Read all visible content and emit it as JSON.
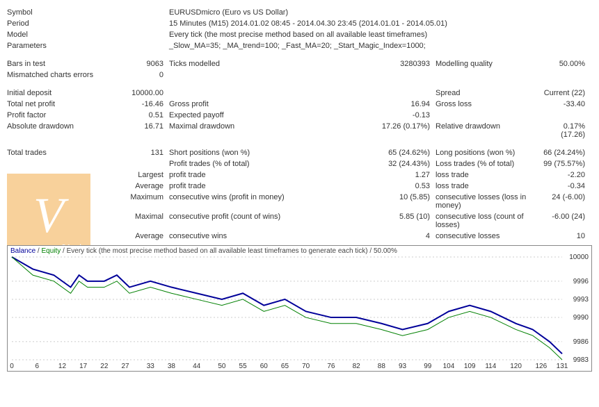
{
  "header": {
    "symbol_label": "Symbol",
    "symbol_value": "EURUSDmicro (Euro vs US Dollar)",
    "period_label": "Period",
    "period_value": "15 Minutes (M15) 2014.01.02 08:45 - 2014.04.30 23:45 (2014.01.01 - 2014.05.01)",
    "model_label": "Model",
    "model_value": "Every tick (the most precise method based on all available least timeframes)",
    "parameters_label": "Parameters",
    "parameters_value": "_Slow_MA=35; _MA_trend=100; _Fast_MA=20; _Start_Magic_Index=1000;"
  },
  "bars": {
    "bars_in_test_label": "Bars in test",
    "bars_in_test_value": "9063",
    "ticks_modelled_label": "Ticks modelled",
    "ticks_modelled_value": "3280393",
    "modelling_quality_label": "Modelling quality",
    "modelling_quality_value": "50.00%",
    "mismatched_label": "Mismatched charts errors",
    "mismatched_value": "0"
  },
  "deposit": {
    "initial_deposit_label": "Initial deposit",
    "initial_deposit_value": "10000.00",
    "spread_label": "Spread",
    "spread_value": "Current (22)",
    "total_net_profit_label": "Total net profit",
    "total_net_profit_value": "-16.46",
    "gross_profit_label": "Gross profit",
    "gross_profit_value": "16.94",
    "gross_loss_label": "Gross loss",
    "gross_loss_value": "-33.40",
    "profit_factor_label": "Profit factor",
    "profit_factor_value": "0.51",
    "expected_payoff_label": "Expected payoff",
    "expected_payoff_value": "-0.13",
    "absolute_dd_label": "Absolute drawdown",
    "absolute_dd_value": "16.71",
    "maximal_dd_label": "Maximal drawdown",
    "maximal_dd_value": "17.26 (0.17%)",
    "relative_dd_label": "Relative drawdown",
    "relative_dd_value": "0.17% (17.26)"
  },
  "trades": {
    "total_trades_label": "Total trades",
    "total_trades_value": "131",
    "short_pos_label": "Short positions (won %)",
    "short_pos_value": "65 (24.62%)",
    "long_pos_label": "Long positions (won %)",
    "long_pos_value": "66 (24.24%)",
    "profit_trades_label": "Profit trades (% of total)",
    "profit_trades_value": "32 (24.43%)",
    "loss_trades_label": "Loss trades (% of total)",
    "loss_trades_value": "99 (75.57%)",
    "largest_label": "Largest",
    "largest_profit_trade_label": "profit trade",
    "largest_profit_trade_value": "1.27",
    "largest_loss_trade_label": "loss trade",
    "largest_loss_trade_value": "-2.20",
    "average_label": "Average",
    "avg_profit_trade_label": "profit trade",
    "avg_profit_trade_value": "0.53",
    "avg_loss_trade_label": "loss trade",
    "avg_loss_trade_value": "-0.34",
    "maximum_label": "Maximum",
    "max_cons_wins_label": "consecutive wins (profit in money)",
    "max_cons_wins_value": "10 (5.85)",
    "max_cons_losses_label": "consecutive losses (loss in money)",
    "max_cons_losses_value": "24 (-6.00)",
    "maximal_label": "Maximal",
    "maximal_cons_profit_label": "consecutive profit (count of wins)",
    "maximal_cons_profit_value": "5.85 (10)",
    "maximal_cons_loss_label": "consecutive loss (count of losses)",
    "maximal_cons_loss_value": "-6.00 (24)",
    "avg2_label": "Average",
    "avg_cons_wins_label": "consecutive wins",
    "avg_cons_wins_value": "4",
    "avg_cons_losses_label": "consecutive losses",
    "avg_cons_losses_value": "10"
  },
  "chart": {
    "legend_balance": "Balance",
    "legend_equity": "Equity",
    "legend_rest": "Every tick (the most precise method based on all available least timeframes to generate each tick) / 50.00%"
  },
  "chart_data": {
    "type": "line",
    "title": "",
    "xlabel": "",
    "ylabel": "",
    "x_ticks": [
      0,
      6,
      12,
      17,
      22,
      27,
      33,
      38,
      44,
      50,
      55,
      60,
      65,
      70,
      76,
      82,
      88,
      93,
      99,
      104,
      109,
      114,
      120,
      126,
      131
    ],
    "y_ticks": [
      9983,
      9986,
      9990,
      9993,
      9996,
      10000
    ],
    "xlim": [
      0,
      131
    ],
    "ylim": [
      9983,
      10000
    ],
    "series": [
      {
        "name": "Balance",
        "color": "#000099",
        "x": [
          0,
          5,
          10,
          14,
          16,
          18,
          22,
          25,
          28,
          33,
          38,
          44,
          50,
          55,
          60,
          65,
          70,
          76,
          82,
          88,
          93,
          99,
          104,
          109,
          114,
          120,
          124,
          128,
          131
        ],
        "y": [
          10000,
          9998,
          9997,
          9995,
          9997,
          9996,
          9996,
          9997,
          9995,
          9996,
          9995,
          9994,
          9993,
          9994,
          9992,
          9993,
          9991,
          9990,
          9990,
          9989,
          9988,
          9989,
          9991,
          9992,
          9991,
          9989,
          9988,
          9986,
          9984
        ]
      },
      {
        "name": "Equity",
        "color": "#008000",
        "x": [
          0,
          5,
          10,
          14,
          16,
          18,
          22,
          25,
          28,
          33,
          38,
          44,
          50,
          55,
          60,
          65,
          70,
          76,
          82,
          88,
          93,
          99,
          104,
          109,
          114,
          120,
          124,
          128,
          131
        ],
        "y": [
          10000,
          9997,
          9996,
          9994,
          9996,
          9995,
          9995,
          9996,
          9994,
          9995,
          9994,
          9993,
          9992,
          9993,
          9991,
          9992,
          9990,
          9989,
          9989,
          9988,
          9987,
          9988,
          9990,
          9991,
          9990,
          9988,
          9987,
          9985,
          9983
        ]
      }
    ]
  }
}
